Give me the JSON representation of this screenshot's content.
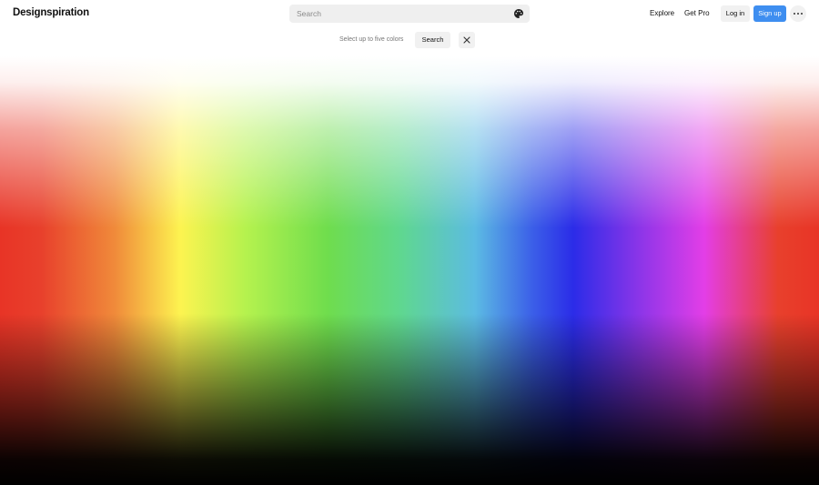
{
  "header": {
    "logo": "Designspiration",
    "search": {
      "placeholder": "Search",
      "value": ""
    },
    "nav": {
      "explore": "Explore",
      "get_pro": "Get Pro"
    },
    "login_label": "Log in",
    "signup_label": "Sign up"
  },
  "color_bar": {
    "hint": "Select up to five colors",
    "search_label": "Search"
  },
  "colors": {
    "accent": "#3e8ef0",
    "button_bg": "#f1f1f1",
    "search_bg": "#efefef"
  },
  "icons": {
    "palette": "palette-icon",
    "more": "more-icon",
    "clear": "close-icon"
  }
}
